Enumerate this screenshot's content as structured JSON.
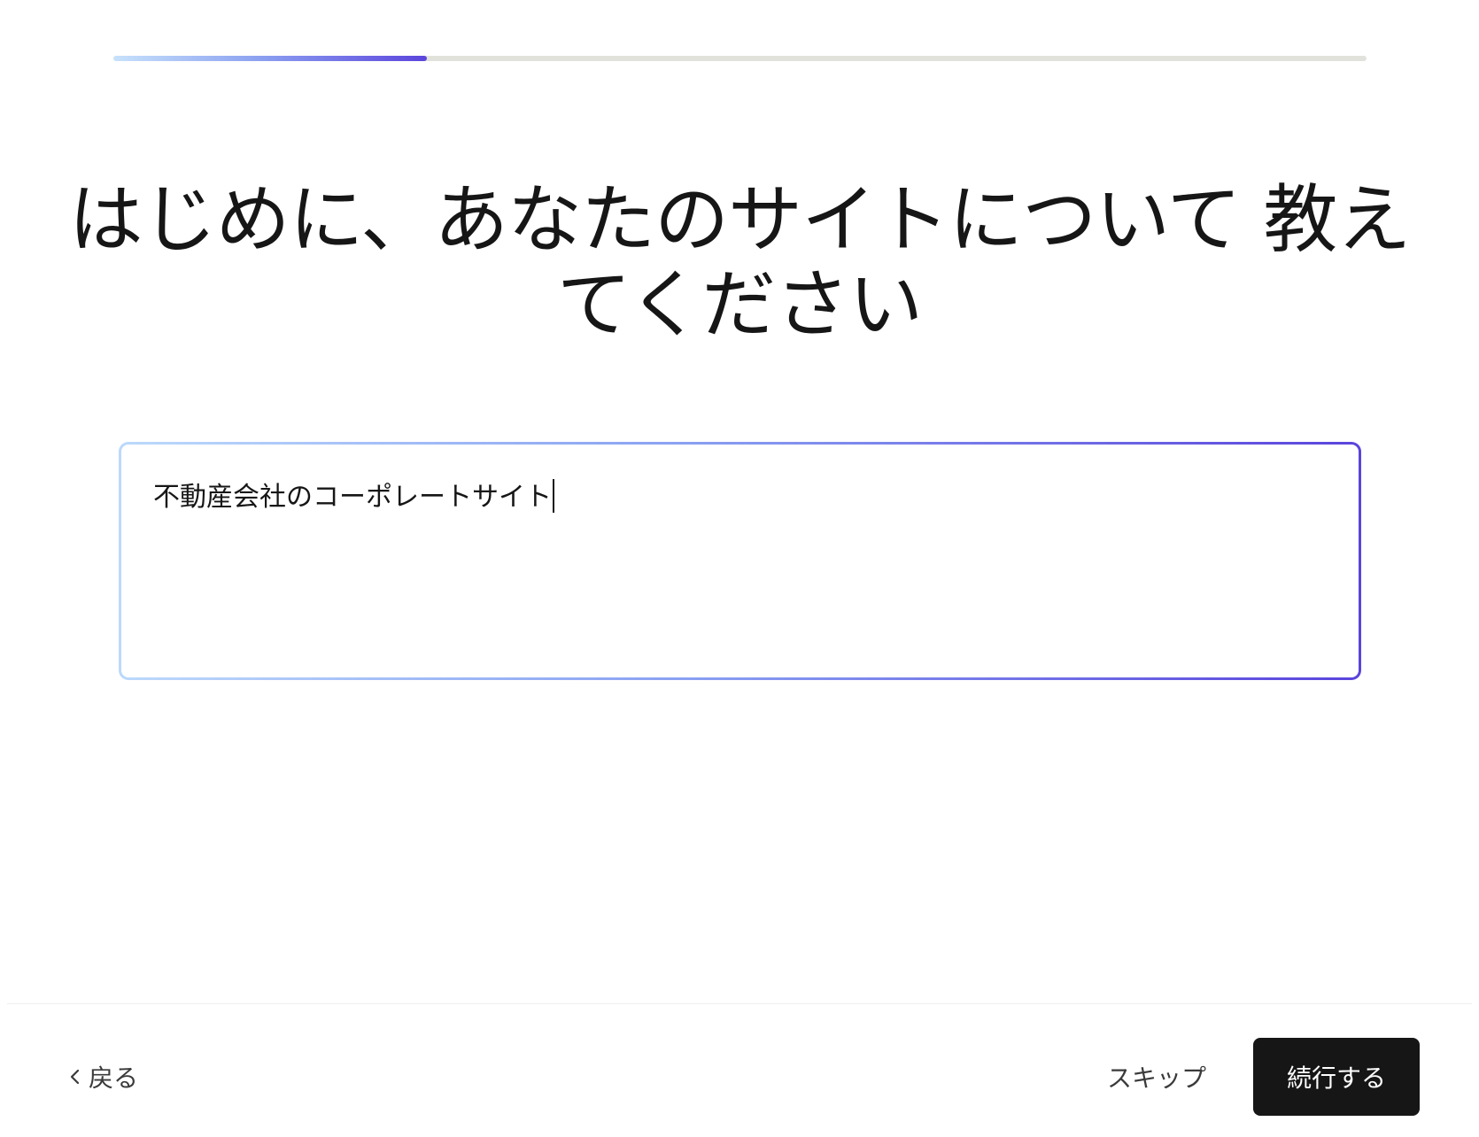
{
  "progress": {
    "fraction": 0.25,
    "colors": [
      "#c7e2fb",
      "#8da3f1",
      "#5b45dc"
    ]
  },
  "heading": {
    "title": "はじめに、あなたのサイトについて 教えてください"
  },
  "site_description": {
    "value": "不動産会社のコーポレートサイト",
    "border_colors": [
      "#bcd9fb",
      "#8aa1f2",
      "#5a44dc"
    ]
  },
  "footer": {
    "back_icon": "chevron-left-icon",
    "back_label": "戻る",
    "skip_label": "スキップ",
    "continue_label": "続行する",
    "continue_bg": "#161616"
  }
}
